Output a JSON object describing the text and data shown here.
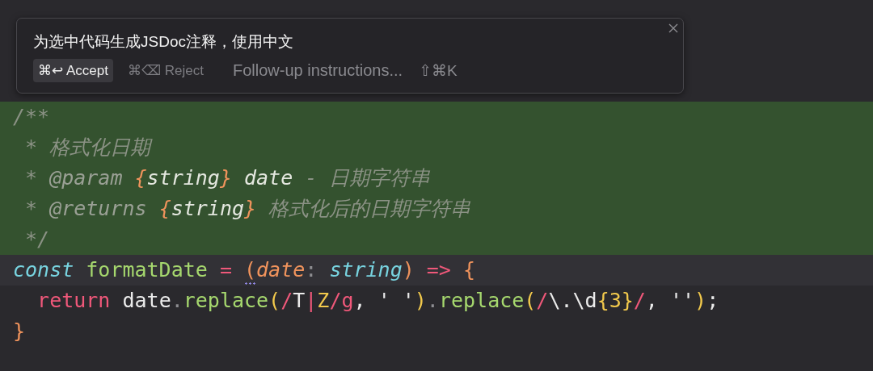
{
  "prompt_popup": {
    "instruction": "为选中代码生成JSDoc注释，使用中文",
    "accept": {
      "shortcut": "⌘↩",
      "label": "Accept"
    },
    "reject": {
      "shortcut": "⌘⌫",
      "label": "Reject"
    },
    "followup": {
      "placeholder": "Follow-up instructions...",
      "shortcut": "⇧⌘K"
    }
  },
  "code_lines": [
    {
      "kind": "added",
      "tokens": [
        {
          "text": "/**",
          "kind": "comment"
        }
      ]
    },
    {
      "kind": "added",
      "tokens": [
        {
          "text": " * ",
          "kind": "comment"
        },
        {
          "text": "格式化日期",
          "kind": "comment"
        }
      ]
    },
    {
      "kind": "added",
      "tokens": [
        {
          "text": " * ",
          "kind": "comment"
        },
        {
          "text": "@param ",
          "kind": "tag"
        },
        {
          "text": "{",
          "kind": "brace"
        },
        {
          "text": "string",
          "kind": "doctype"
        },
        {
          "text": "}",
          "kind": "brace"
        },
        {
          "text": " date",
          "kind": "doctype"
        },
        {
          "text": " - 日期字符串",
          "kind": "comment"
        }
      ]
    },
    {
      "kind": "added",
      "tokens": [
        {
          "text": " * ",
          "kind": "comment"
        },
        {
          "text": "@returns ",
          "kind": "tag"
        },
        {
          "text": "{",
          "kind": "brace"
        },
        {
          "text": "string",
          "kind": "doctype"
        },
        {
          "text": "}",
          "kind": "brace"
        },
        {
          "text": " 格式化后的日期字符串",
          "kind": "comment"
        }
      ]
    },
    {
      "kind": "added",
      "tokens": [
        {
          "text": " */",
          "kind": "comment"
        }
      ]
    },
    {
      "kind": "current",
      "tokens": [
        {
          "text": "const ",
          "kind": "keyword"
        },
        {
          "text": "formatDate ",
          "kind": "func"
        },
        {
          "text": "= ",
          "kind": "op"
        },
        {
          "text": "(",
          "kind": "paren",
          "hint": true
        },
        {
          "text": "date",
          "kind": "param"
        },
        {
          "text": ": ",
          "kind": "punct"
        },
        {
          "text": "string",
          "kind": "keyword"
        },
        {
          "text": ") ",
          "kind": "paren"
        },
        {
          "text": "=> ",
          "kind": "op"
        },
        {
          "text": "{",
          "kind": "paren"
        }
      ]
    },
    {
      "kind": "normal",
      "tokens": [
        {
          "text": "  return",
          "kind": "op"
        },
        {
          "text": " date",
          "kind": "plain"
        },
        {
          "text": ".",
          "kind": "punct"
        },
        {
          "text": "replace",
          "kind": "func"
        },
        {
          "text": "(",
          "kind": "bracket"
        },
        {
          "text": "/",
          "kind": "op"
        },
        {
          "text": "T",
          "kind": "plain"
        },
        {
          "text": "|",
          "kind": "op"
        },
        {
          "text": "Z",
          "kind": "bracket"
        },
        {
          "text": "/g",
          "kind": "op"
        },
        {
          "text": ", ' '",
          "kind": "plain"
        },
        {
          "text": ")",
          "kind": "bracket"
        },
        {
          "text": ".",
          "kind": "punct"
        },
        {
          "text": "replace",
          "kind": "func"
        },
        {
          "text": "(",
          "kind": "bracket"
        },
        {
          "text": "/",
          "kind": "op"
        },
        {
          "text": "\\.\\d",
          "kind": "plain"
        },
        {
          "text": "{3}",
          "kind": "bracket"
        },
        {
          "text": "/",
          "kind": "op"
        },
        {
          "text": ", ''",
          "kind": "plain"
        },
        {
          "text": ")",
          "kind": "bracket"
        },
        {
          "text": ";",
          "kind": "plain"
        }
      ]
    },
    {
      "kind": "normal",
      "tokens": [
        {
          "text": "}",
          "kind": "paren"
        }
      ]
    }
  ]
}
